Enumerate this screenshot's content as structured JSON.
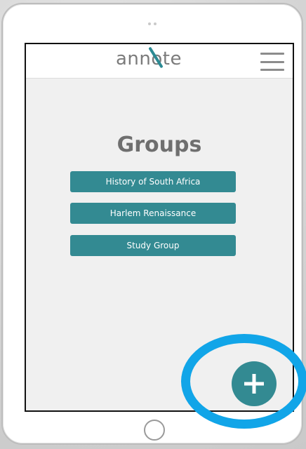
{
  "app": {
    "logo_text": "annote",
    "brand_color": "#338a92"
  },
  "header": {
    "menu_icon": "hamburger-menu-icon"
  },
  "main": {
    "title": "Groups",
    "groups": [
      {
        "label": "History of South Africa"
      },
      {
        "label": "Harlem Renaissance"
      },
      {
        "label": "Study Group"
      }
    ]
  },
  "fab": {
    "icon": "plus-icon"
  },
  "annotation": {
    "color": "#11a5e8"
  }
}
